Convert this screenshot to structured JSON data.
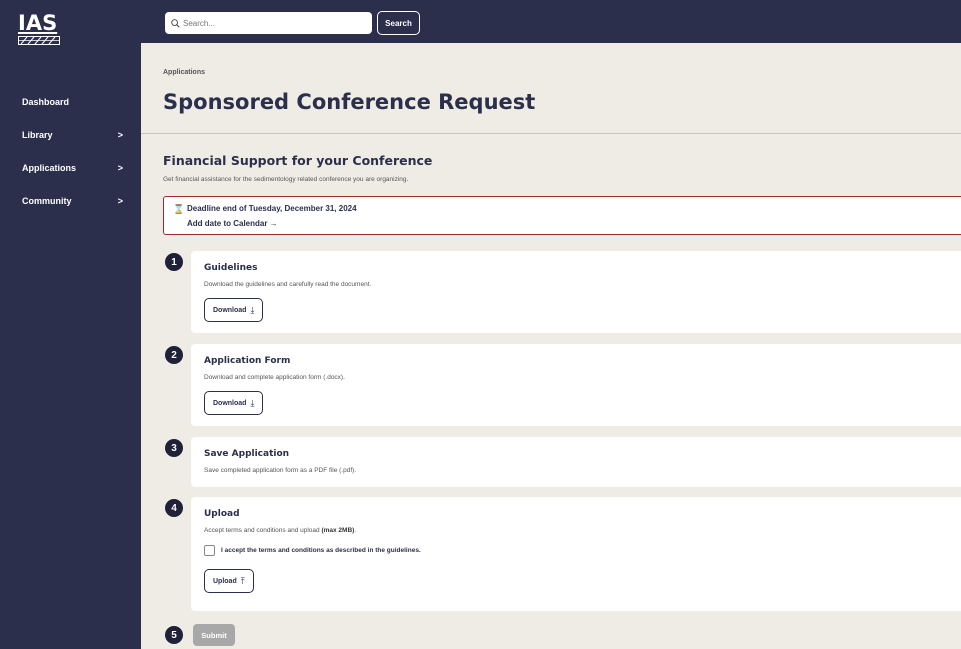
{
  "logo": {
    "text": "IAS"
  },
  "sidebar": {
    "items": [
      {
        "label": "Dashboard",
        "chevron": ""
      },
      {
        "label": "Library",
        "chevron": ">"
      },
      {
        "label": "Applications",
        "chevron": ">"
      },
      {
        "label": "Community",
        "chevron": ">"
      }
    ]
  },
  "topbar": {
    "search_placeholder": "Search...",
    "search_button": "Search"
  },
  "page": {
    "breadcrumb": "Applications",
    "title": "Sponsored Conference Request"
  },
  "section": {
    "title": "Financial Support for your Conference",
    "description": "Get financial assistance for the sedimentology related conference you are organizing."
  },
  "deadline": {
    "icon": "hourglass-icon",
    "text": "Deadline end of Tuesday, December 31, 2024",
    "calendar_link": "Add date to Calendar →"
  },
  "steps": [
    {
      "number": "1",
      "title": "Guidelines",
      "description": "Download the guidelines and carefully read the document.",
      "button": "Download",
      "button_icon": "download-icon"
    },
    {
      "number": "2",
      "title": "Application Form",
      "description": "Download and complete application form (.docx).",
      "button": "Download",
      "button_icon": "download-icon"
    },
    {
      "number": "3",
      "title": "Save Application",
      "description": "Save completed application form as a PDF file (.pdf)."
    },
    {
      "number": "4",
      "title": "Upload",
      "description_prefix": "Accept terms and conditions and upload ",
      "description_bold": "(max 2MB)",
      "description_suffix": ".",
      "terms_label": "I accept the terms and conditions as described in the guidelines.",
      "button": "Upload",
      "button_icon": "upload-icon"
    },
    {
      "number": "5",
      "button": "Submit"
    }
  ],
  "colors": {
    "navy": "#2b2f4b",
    "background": "#efece6",
    "deadline_border": "#9b2b2b",
    "disabled": "#a8a8a8"
  }
}
